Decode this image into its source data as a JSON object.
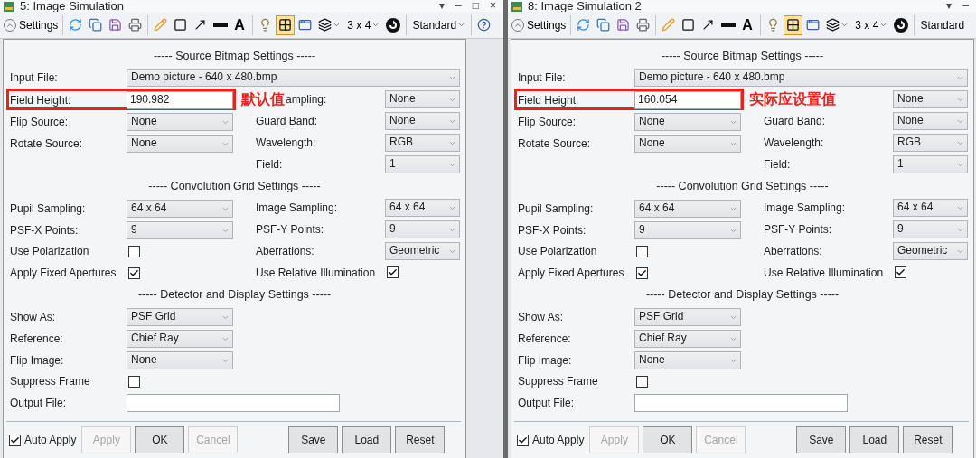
{
  "windows": [
    {
      "title": "5: Image Simulation",
      "controls": [
        "▾",
        "–",
        "□",
        "×"
      ],
      "toolbar": {
        "settings": "Settings",
        "tool_groups": [
          [
            {
              "kind": "refresh",
              "selected": false
            },
            {
              "kind": "copy",
              "selected": false
            },
            {
              "kind": "save",
              "selected": false
            },
            {
              "kind": "print",
              "selected": false
            }
          ],
          [
            {
              "kind": "pencil",
              "selected": false
            },
            {
              "kind": "rectangle",
              "selected": false
            },
            {
              "kind": "arrow",
              "selected": false
            },
            {
              "kind": "line",
              "selected": false
            },
            {
              "kind": "text",
              "label": "A",
              "selected": false
            }
          ],
          [
            {
              "kind": "lamp",
              "selected": false
            },
            {
              "kind": "grid",
              "selected": true
            },
            {
              "kind": "windows",
              "selected": false
            },
            {
              "kind": "layers",
              "selected": false
            },
            {
              "kind": "menu",
              "label": "3 x 4",
              "selected": false
            },
            {
              "kind": "rotate",
              "selected": false
            }
          ],
          [
            {
              "kind": "menu",
              "label": "Standard",
              "selected": false
            }
          ],
          [
            {
              "kind": "help",
              "selected": false
            }
          ]
        ]
      },
      "sections": [
        {
          "title": "----- Source Bitmap Settings -----",
          "rows": [
            {
              "highlighted": false,
              "left": {
                "label": "Input File:",
                "kind": "wide-dropdown",
                "value": "Demo picture -  640 x 480.bmp"
              }
            },
            {
              "highlighted": true,
              "note": "默认值",
              "left": {
                "label": "Field Height:",
                "kind": "text",
                "value": "190.982"
              },
              "right": {
                "label": "ampling:",
                "kind": "dropdown",
                "value": "None"
              }
            },
            {
              "highlighted": false,
              "left": {
                "label": "Flip Source:",
                "kind": "dropdown",
                "value": "None"
              },
              "right": {
                "label": "Guard Band:",
                "kind": "dropdown",
                "value": "None"
              }
            },
            {
              "highlighted": false,
              "left": {
                "label": "Rotate Source:",
                "kind": "dropdown",
                "value": "None"
              },
              "right": {
                "label": "Wavelength:",
                "kind": "dropdown",
                "value": "RGB"
              }
            },
            {
              "highlighted": false,
              "right": {
                "label": "Field:",
                "kind": "dropdown",
                "value": "1"
              }
            }
          ]
        },
        {
          "title": "----- Convolution Grid Settings -----",
          "rows": [
            {
              "left": {
                "label": "Pupil Sampling:",
                "kind": "dropdown",
                "value": "64 x 64"
              },
              "right": {
                "label": "Image Sampling:",
                "kind": "dropdown",
                "value": "64 x 64"
              }
            },
            {
              "left": {
                "label": "PSF-X Points:",
                "kind": "dropdown",
                "value": "9"
              },
              "right": {
                "label": "PSF-Y Points:",
                "kind": "dropdown",
                "value": "9"
              }
            },
            {
              "left": {
                "label": "Use Polarization",
                "kind": "checkbox",
                "checked": false
              },
              "right": {
                "label": "Aberrations:",
                "kind": "dropdown",
                "value": "Geometric"
              }
            },
            {
              "left": {
                "label": "Apply Fixed Apertures",
                "kind": "checkbox",
                "checked": true
              },
              "right": {
                "label": "Use Relative Illumination",
                "kind": "checkbox",
                "checked": true
              }
            }
          ]
        },
        {
          "title": "----- Detector and Display Settings -----",
          "rows": [
            {
              "left": {
                "label": "Show As:",
                "kind": "dropdown",
                "value": "PSF Grid"
              }
            },
            {
              "left": {
                "label": "Reference:",
                "kind": "dropdown",
                "value": "Chief Ray"
              }
            },
            {
              "left": {
                "label": "Flip Image:",
                "kind": "dropdown",
                "value": "None"
              }
            },
            {
              "left": {
                "label": "Suppress Frame",
                "kind": "checkbox",
                "checked": false
              }
            },
            {
              "left": {
                "label": "Output File:",
                "kind": "wide-text"
              }
            }
          ]
        }
      ],
      "auto_apply": {
        "label": "Auto Apply",
        "checked": true
      },
      "buttons": [
        {
          "label": "Apply",
          "disabled": true
        },
        {
          "label": "OK",
          "disabled": false
        },
        {
          "label": "Cancel",
          "disabled": true
        }
      ],
      "file_buttons": [
        {
          "label": "Save",
          "disabled": false
        },
        {
          "label": "Load",
          "disabled": false
        },
        {
          "label": "Reset",
          "disabled": false
        }
      ]
    },
    {
      "title": "8: Image Simulation 2",
      "controls": [
        "▾",
        "–"
      ],
      "toolbar": {
        "settings": "Settings",
        "tool_groups": [
          [
            {
              "kind": "refresh",
              "selected": false
            },
            {
              "kind": "copy",
              "selected": false
            },
            {
              "kind": "save",
              "selected": false
            },
            {
              "kind": "print",
              "selected": false
            }
          ],
          [
            {
              "kind": "pencil",
              "selected": false
            },
            {
              "kind": "rectangle",
              "selected": false
            },
            {
              "kind": "arrow",
              "selected": false
            },
            {
              "kind": "line",
              "selected": false
            },
            {
              "kind": "text",
              "label": "A",
              "selected": false
            }
          ],
          [
            {
              "kind": "lamp",
              "selected": false
            },
            {
              "kind": "grid",
              "selected": true
            },
            {
              "kind": "windows",
              "selected": false
            },
            {
              "kind": "layers",
              "selected": false
            },
            {
              "kind": "menu",
              "label": "3 x 4",
              "selected": false
            },
            {
              "kind": "rotate",
              "selected": false
            }
          ],
          [
            {
              "kind": "label",
              "label": "Standard",
              "selected": false
            }
          ]
        ]
      },
      "sections": [
        {
          "title": "----- Source Bitmap Settings -----",
          "rows": [
            {
              "highlighted": false,
              "left": {
                "label": "Input File:",
                "kind": "wide-dropdown",
                "value": "Demo picture -  640 x 480.bmp"
              }
            },
            {
              "highlighted": true,
              "note": "实际应设置值",
              "left": {
                "label": "Field Height:",
                "kind": "text",
                "value": "160.054"
              },
              "right": {
                "kind": "dropdown",
                "value": "None"
              }
            },
            {
              "highlighted": false,
              "left": {
                "label": "Flip Source:",
                "kind": "dropdown",
                "value": "None"
              },
              "right": {
                "label": "Guard Band:",
                "kind": "dropdown",
                "value": "None"
              }
            },
            {
              "highlighted": false,
              "left": {
                "label": "Rotate Source:",
                "kind": "dropdown",
                "value": "None"
              },
              "right": {
                "label": "Wavelength:",
                "kind": "dropdown",
                "value": "RGB"
              }
            },
            {
              "highlighted": false,
              "right": {
                "label": "Field:",
                "kind": "dropdown",
                "value": "1"
              }
            }
          ]
        },
        {
          "title": "----- Convolution Grid Settings -----",
          "rows": [
            {
              "left": {
                "label": "Pupil Sampling:",
                "kind": "dropdown",
                "value": "64 x 64"
              },
              "right": {
                "label": "Image Sampling:",
                "kind": "dropdown",
                "value": "64 x 64"
              }
            },
            {
              "left": {
                "label": "PSF-X Points:",
                "kind": "dropdown",
                "value": "9"
              },
              "right": {
                "label": "PSF-Y Points:",
                "kind": "dropdown",
                "value": "9"
              }
            },
            {
              "left": {
                "label": "Use Polarization",
                "kind": "checkbox",
                "checked": false
              },
              "right": {
                "label": "Aberrations:",
                "kind": "dropdown",
                "value": "Geometric"
              }
            },
            {
              "left": {
                "label": "Apply Fixed Apertures",
                "kind": "checkbox",
                "checked": true
              },
              "right": {
                "label": "Use Relative Illumination",
                "kind": "checkbox",
                "checked": true
              }
            }
          ]
        },
        {
          "title": "----- Detector and Display Settings -----",
          "rows": [
            {
              "left": {
                "label": "Show As:",
                "kind": "dropdown",
                "value": "PSF Grid"
              }
            },
            {
              "left": {
                "label": "Reference:",
                "kind": "dropdown",
                "value": "Chief Ray"
              }
            },
            {
              "left": {
                "label": "Flip Image:",
                "kind": "dropdown",
                "value": "None"
              }
            },
            {
              "left": {
                "label": "Suppress Frame",
                "kind": "checkbox",
                "checked": false
              }
            },
            {
              "left": {
                "label": "Output File:",
                "kind": "wide-text"
              }
            }
          ]
        }
      ],
      "auto_apply": {
        "label": "Auto Apply",
        "checked": true
      },
      "buttons": [
        {
          "label": "Apply",
          "disabled": true
        },
        {
          "label": "OK",
          "disabled": false
        },
        {
          "label": "Cancel",
          "disabled": true
        }
      ],
      "file_buttons": [
        {
          "label": "Save",
          "disabled": false
        },
        {
          "label": "Load",
          "disabled": false
        },
        {
          "label": "Reset",
          "disabled": false
        }
      ]
    }
  ]
}
